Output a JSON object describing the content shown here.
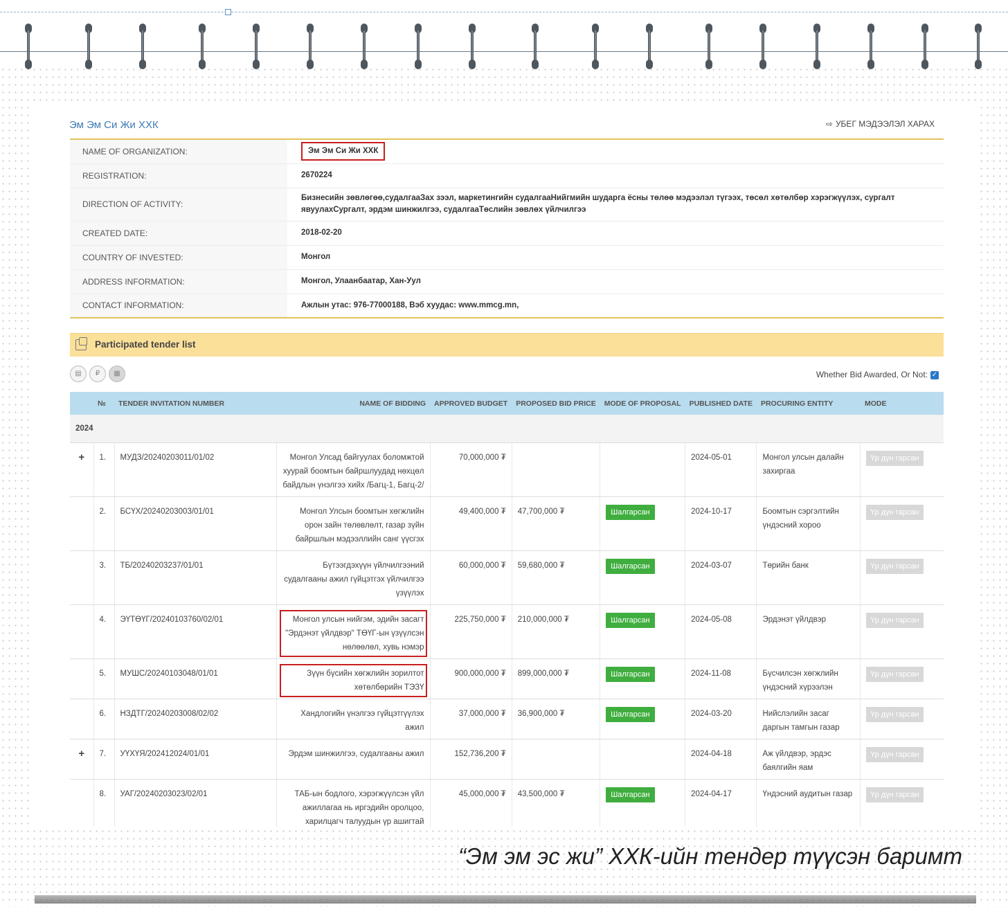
{
  "org": {
    "title": "Эм Эм Си Жи ХХК",
    "back_link": "УБЕГ МЭДЭЭЛЭЛ ХАРАХ"
  },
  "info_rows": [
    {
      "key": "NAME OF ORGANIZATION:",
      "value": "Эм Эм Си Жи ХХК"
    },
    {
      "key": "REGISTRATION:",
      "value": "2670224"
    },
    {
      "key": "DIRECTION OF ACTIVITY:",
      "value": "Бизнесийн зөвлөгөө,судалгааЗах зээл, маркетингийн судалгааНийгмийн шударга ёсны төлөө мэдээлэл түгээх, төсөл хөтөлбөр хэрэгжүүлэх, сургалт явуулахСургалт, эрдэм шинжилгээ, судалгааТөслийн зөвлөх үйлчилгээ"
    },
    {
      "key": "CREATED DATE:",
      "value": "2018-02-20"
    },
    {
      "key": "COUNTRY OF INVESTED:",
      "value": "Монгол"
    },
    {
      "key": "ADDRESS INFORMATION:",
      "value": "Монгол, Улаанбаатар, Хан-Уул"
    },
    {
      "key": "CONTACT INFORMATION:",
      "value": "Ажлын утас: 976-77000188, Вэб хуудас: www.mmcg.mn,"
    }
  ],
  "tender_section": {
    "title": "Participated tender list",
    "awarded_label": "Whether Bid Awarded, Or Not:",
    "toolbar": [
      "▤",
      "₽",
      "▦"
    ]
  },
  "columns": [
    "№",
    "TENDER INVITATION NUMBER",
    "NAME OF BIDDING",
    "APPROVED BUDGET",
    "PROPOSED BID PRICE",
    "MODE OF PROPOSAL",
    "PUBLISHED DATE",
    "PROCURING ENTITY",
    "MODE"
  ],
  "year": "2024",
  "rows": [
    {
      "expand": "+",
      "no": "1.",
      "number": "МУДЗ/20240203011/01/02",
      "name": "Монгол Улсад байгуулах боломжтой хуурай боомтын байршлуудад нөхцөл байдлын үнэлгээ хийх /Багц-1, Багц-2/",
      "budget": "70,000,000 ₮",
      "bid": "",
      "mode_proposal": "",
      "date": "2024-05-01",
      "entity": "Монгол улсын далайн захиргаа",
      "mode": "Үр дүн гарсан"
    },
    {
      "expand": "",
      "no": "2.",
      "number": "БСҮХ/20240203003/01/01",
      "name": "Монгол Улсын боомтын хөгжлийн орон зайн төлөвлөлт, газар зүйн байршлын мэдээллийн санг үүсгэх",
      "budget": "49,400,000 ₮",
      "bid": "47,700,000 ₮",
      "mode_proposal": "Шалгарсан",
      "date": "2024-10-17",
      "entity": "Боомтын сэргэлтийн үндэсний хороо",
      "mode": "Үр дүн гарсан"
    },
    {
      "expand": "",
      "no": "3.",
      "number": "ТБ/20240203237/01/01",
      "name": "Бүтээгдэхүүн үйлчилгээний судалгааны ажил гүйцэтгэх үйлчилгээ үзүүлэх",
      "budget": "60,000,000 ₮",
      "bid": "59,680,000 ₮",
      "mode_proposal": "Шалгарсан",
      "date": "2024-03-07",
      "entity": "Төрийн банк",
      "mode": "Үр дүн гарсан"
    },
    {
      "expand": "",
      "no": "4.",
      "number": "ЭҮТӨҮГ/20240103760/02/01",
      "name": "Монгол улсын нийгэм, эдийн засагт \"Эрдэнэт үйлдвэр\" ТӨҮГ-ын үзүүлсэн нөлөөлөл, хувь нэмэр",
      "budget": "225,750,000 ₮",
      "bid": "210,000,000 ₮",
      "mode_proposal": "Шалгарсан",
      "date": "2024-05-08",
      "entity": "Эрдэнэт үйлдвэр",
      "mode": "Үр дүн гарсан",
      "highlight": true
    },
    {
      "expand": "",
      "no": "5.",
      "number": "МУШС/20240103048/01/01",
      "name": "Зүүн бүсийн хөгжлийн зорилтот хөтөлбөрийн ТЭЗҮ",
      "budget": "900,000,000 ₮",
      "bid": "899,000,000 ₮",
      "mode_proposal": "Шалгарсан",
      "date": "2024-11-08",
      "entity": "Бүсчилсэн хөгжлийн үндэсний хүрээлэн",
      "mode": "Үр дүн гарсан",
      "highlight": true
    },
    {
      "expand": "",
      "no": "6.",
      "number": "НЗДТГ/20240203008/02/02",
      "name": "Хандлогийн үнэлгээ гүйцэтгүүлэх ажил",
      "budget": "37,000,000 ₮",
      "bid": "36,900,000 ₮",
      "mode_proposal": "Шалгарсан",
      "date": "2024-03-20",
      "entity": "Нийслэлийн засаг даргын тамгын газар",
      "mode": "Үр дүн гарсан"
    },
    {
      "expand": "+",
      "no": "7.",
      "number": "УҮХҮЯ/202412024/01/01",
      "name": "Эрдэм шинжилгээ, судалгааны ажил",
      "budget": "152,736,200 ₮",
      "bid": "",
      "mode_proposal": "",
      "date": "2024-04-18",
      "entity": "Аж үйлдвэр, эрдэс баялгийн яам",
      "mode": "Үр дүн гарсан"
    },
    {
      "expand": "",
      "no": "8.",
      "number": "УАГ/20240203023/02/01",
      "name": "ТАБ-ын бодлого, хэрэгжүүлсэн үйл ажиллагаа нь иргэдийн оролцоо, харилцагч талуудын үр ашигтай хамтын ажиллагаанд бий болгож байгаа эсэх",
      "budget": "45,000,000 ₮",
      "bid": "43,500,000 ₮",
      "mode_proposal": "Шалгарсан",
      "date": "2024-04-17",
      "entity": "Үндэсний аудитын газар",
      "mode": "Үр дүн гарсан"
    }
  ],
  "caption": "“Эм эм эс жи” ХХК-ийн тендер түүсэн баримт"
}
